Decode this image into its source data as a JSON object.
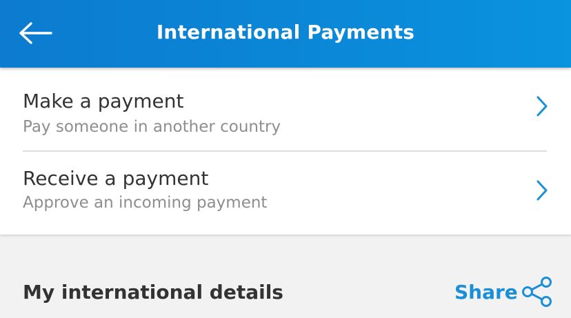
{
  "header": {
    "title": "International Payments",
    "back_icon": "arrow-left-icon"
  },
  "menu": {
    "items": [
      {
        "title": "Make a payment",
        "subtitle": "Pay someone in another country",
        "icon": "chevron-right-icon"
      },
      {
        "title": "Receive a payment",
        "subtitle": "Approve an incoming payment",
        "icon": "chevron-right-icon"
      }
    ]
  },
  "details": {
    "title": "My international details",
    "share_label": "Share",
    "share_icon": "share-icon"
  },
  "colors": {
    "header_blue": "#0b86d6",
    "accent_blue": "#1a8fd8",
    "text_dark": "#333333",
    "text_muted": "#8e8e8e",
    "background": "#f2f2f2"
  }
}
